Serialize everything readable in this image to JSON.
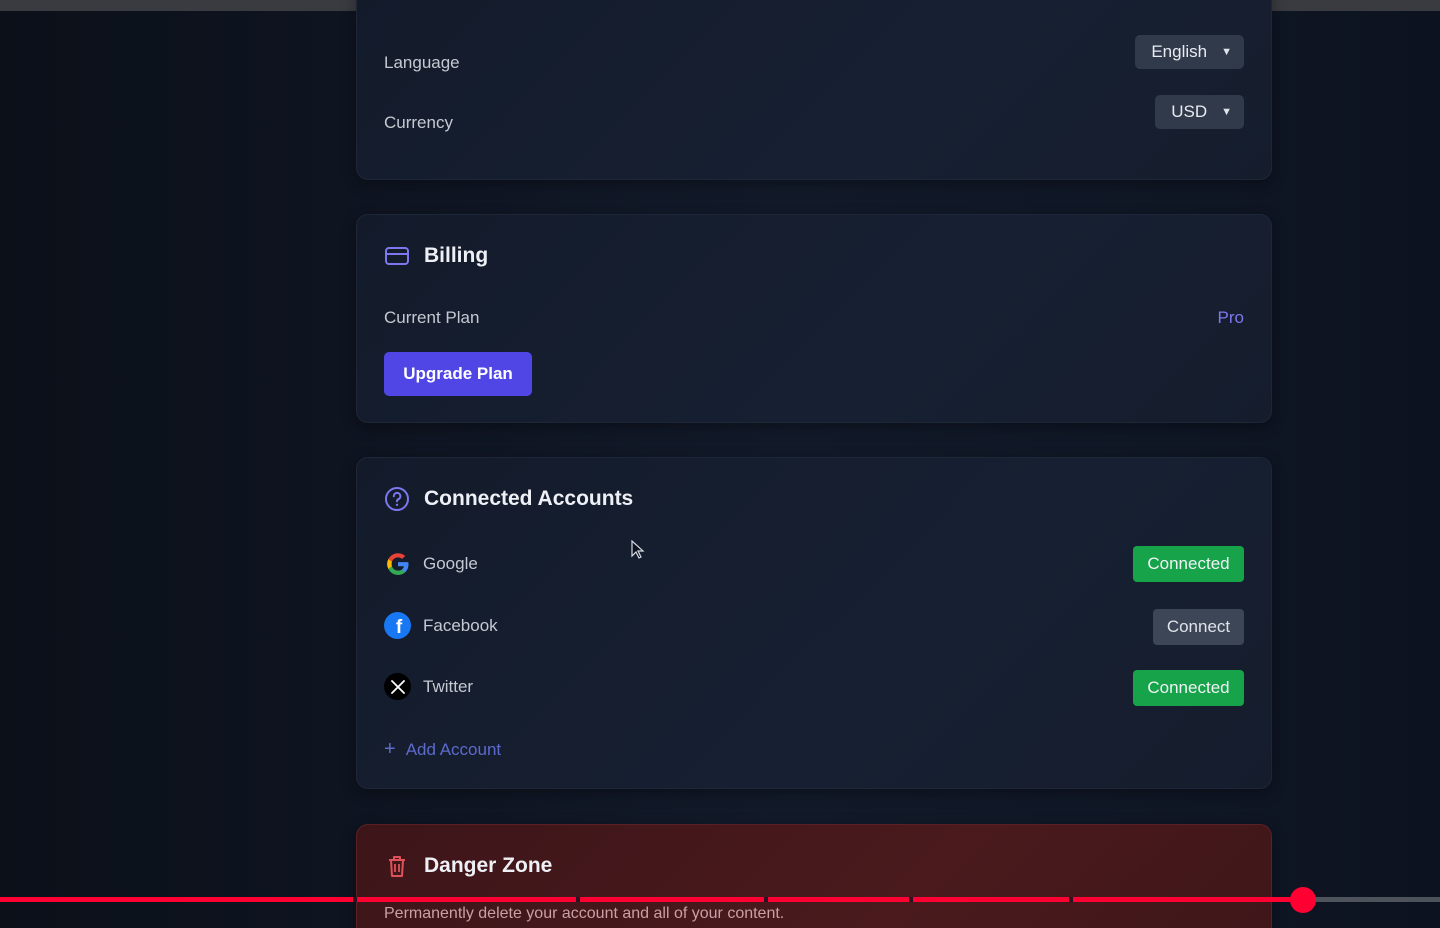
{
  "preferences": {
    "language": {
      "label": "Language",
      "value": "English"
    },
    "currency": {
      "label": "Currency",
      "value": "USD"
    }
  },
  "billing": {
    "title": "Billing",
    "current_plan_label": "Current Plan",
    "current_plan_value": "Pro",
    "upgrade_button": "Upgrade Plan"
  },
  "connected_accounts": {
    "title": "Connected Accounts",
    "items": [
      {
        "name": "Google",
        "status": "Connected",
        "icon": "google-icon"
      },
      {
        "name": "Facebook",
        "status": "Connect",
        "icon": "facebook-icon"
      },
      {
        "name": "Twitter",
        "status": "Connected",
        "icon": "x-twitter-icon"
      }
    ],
    "add_account": "Add Account"
  },
  "danger_zone": {
    "title": "Danger Zone",
    "description": "Permanently delete your account and all of your content."
  },
  "video_player": {
    "progress_fraction": 0.905
  },
  "colors": {
    "accent": "#4f46e5",
    "plan_text": "#7b78f0",
    "connected": "#16a34a",
    "danger_bg": "#4a1a1d",
    "progress": "#ff0033"
  }
}
